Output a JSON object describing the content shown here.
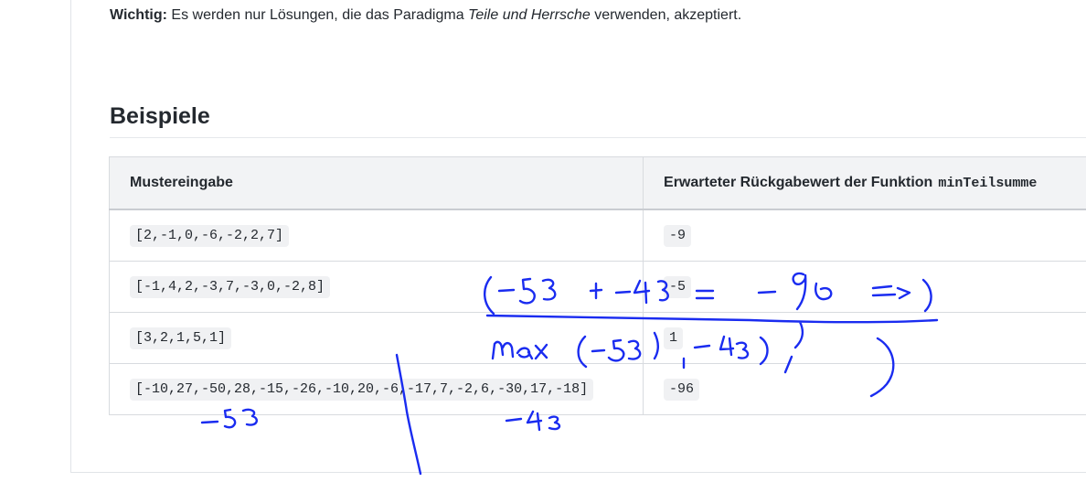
{
  "note": {
    "label": "Wichtig:",
    "text_before": " Es werden nur Lösungen, die das Paradigma ",
    "emphasis": "Teile und Herrsche",
    "text_after": " verwenden, akzeptiert."
  },
  "section": {
    "heading": "Beispiele"
  },
  "table": {
    "headers": {
      "input": "Mustereingabe",
      "output_prefix": "Erwarteter Rückgabewert der Funktion",
      "output_code": "minTeilsumme"
    },
    "rows": [
      {
        "input": "[2,-1,0,-6,-2,2,7]",
        "output": "-9"
      },
      {
        "input": "[-1,4,2,-3,7,-3,0,-2,8]",
        "output": "-5"
      },
      {
        "input": "[3,2,1,5,1]",
        "output": "1"
      },
      {
        "input": "[-10,27,-50,28,-15,-26,-10,20,-6,-17,7,-2,6,-30,17,-18]",
        "output": "-96"
      }
    ]
  },
  "annotations": {
    "ink_color": "#1a2cf0",
    "strokes": [
      "divider-line",
      "left-sum -53",
      "right-sum -43",
      "min expression",
      "max expression",
      "brace"
    ]
  }
}
